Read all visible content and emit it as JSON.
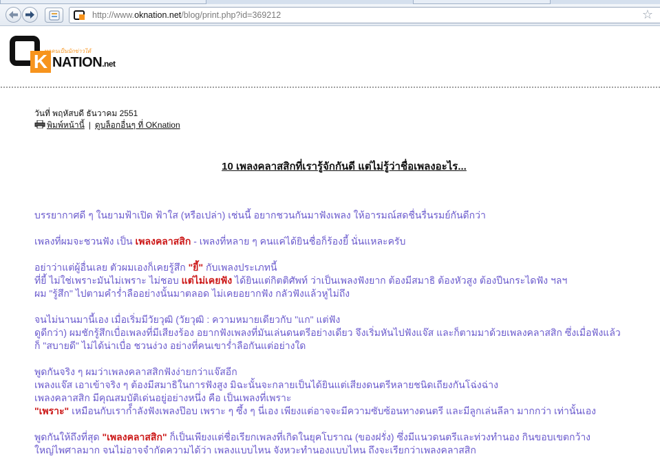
{
  "browser": {
    "url_prefix": "http://www.",
    "url_host": "oknation.net",
    "url_suffix": "/blog/print.php?id=369212"
  },
  "site": {
    "logo_letter": "K",
    "logo_tagline": "ทุกคนเป็นนักข่าวได้",
    "logo_name": "NATION",
    "logo_tld": ".net"
  },
  "post": {
    "date": "วันที่ พฤหัสบดี ธันวาคม 2551",
    "print_link": "พิมพ์หน้านี้",
    "separator": "|",
    "other_blogs_link": "ดูบล็อกอื่นๆ ที่ OKnation",
    "title": "10 เพลงคลาสสิกที่เรารู้จักกันดี แต่ไม่รู้ว่าชื่อเพลงอะไร...",
    "p1": "บรรยากาศดี ๆ ในยามฟ้าเปิด ฟ้าใส (หรือเปล่า) เช่นนี้ อยากชวนกันมาฟังเพลง ให้อารมณ์สดชื่นรื่นรมย์กันดีกว่า",
    "p2_a": "เพลงที่ผมจะชวนฟัง เป็น ",
    "p2_b": "เพลงคลาสสิก",
    "p2_c": " - เพลงที่หลาย ๆ คนแค่ได้ยินชื่อก็ร้องยี้ นั่นแหละครับ",
    "p3_l1_a": "อย่าว่าแต่ผู้อื่นเลย ตัวผมเองก็เคยรู้สึก ",
    "p3_l1_b": "\"ยี้\"",
    "p3_l1_c": " กับเพลงประเภทนี้",
    "p3_l2_a": "ที่ยี้ ไม่ใช่เพราะมันไม่เพราะ ไม่ชอบ ",
    "p3_l2_b": "แต่ไม่เคยฟัง",
    "p3_l2_c": " ได้ยินแต่กิตติศัพท์ ว่าเป็นเพลงฟังยาก ต้องมีสมาธิ ต้องหัวสูง ต้องปีนกระไดฟัง ฯลฯ",
    "p3_l3": "ผม \"รู้สึก\" ไปตามคำร่ำลืออย่างนั้นมาตลอด ไม่เคยอยากฟัง กลัวฟังแล้วหูไม่ถึง",
    "p4_l1": "จนไม่นานมานี้เอง เมื่อเริ่มมีวัยวุฒิ (วัยวุฒิ : ความหมายเดียวกับ \"แก\" แต่ฟัง",
    "p4_l2": "ดูดีกว่า) ผมชักรู้สึกเบื่อเพลงที่มีเสียงร้อง อยากฟังเพลงที่มันเล่นดนตรีอย่างเดียว จึงเริ่มหันไปฟังแจ๊ส และก็ตามมาด้วยเพลงคลาสสิก ซึ่งเมื่อฟังแล้ว",
    "p4_l3": "ก็ \"สบายดี\" ไม่ได้น่าเบื่อ ชวนง่วง อย่างที่คนเขาร่ำลือกันแต่อย่างใด",
    "p5_l1": "พูดกันจริง ๆ ผมว่าเพลงคลาสสิกฟังง่ายกว่าแจ๊สอีก",
    "p5_l2": "เพลงแจ๊ส เอาเข้าจริง ๆ ต้องมีสมาธิในการฟังสูง มิฉะนั้นจะกลายเป็นได้ยินแต่เสียงดนตรีหลายชนิดเถียงกันโฉ่งฉ่าง",
    "p5_l3": "เพลงคลาสสิก มีคุณสมบัติเด่นอยู่อย่างหนึ่ง คือ เป็นเพลงที่เพราะ",
    "p5_l4_a": "\"เพราะ\"",
    "p5_l4_b": " เหมือนกับเราก็ำลังฟังเพลงป๊อบ เพราะ ๆ ซึ้ง ๆ นี่เอง เพียงแต่อาจจะมีความซับซ้อนทางดนตรี และมีลูกเล่นลีลา มากกว่า เท่านั้นเอง",
    "p6_l1_a": "พูดกันให้ถึงที่สุด ",
    "p6_l1_b": "\"เพลงคลาสสิก\"",
    "p6_l1_c": " ก็เป็นเพียงแต่ชื่อเรียกเพลงที่เกิดในยุคโบราณ (ของฝรั่ง) ซึ่งมีแนวดนตรีและท่วงทำนอง กินขอบเขตกว้าง",
    "p6_l2": "ใหญ่ไพศาลมาก จนไม่อาจจำกัดความได้ว่า เพลงแบบไหน จังหวะทำนองแบบไหน ถึงจะเรียกว่าเพลงคลาสสิก"
  }
}
